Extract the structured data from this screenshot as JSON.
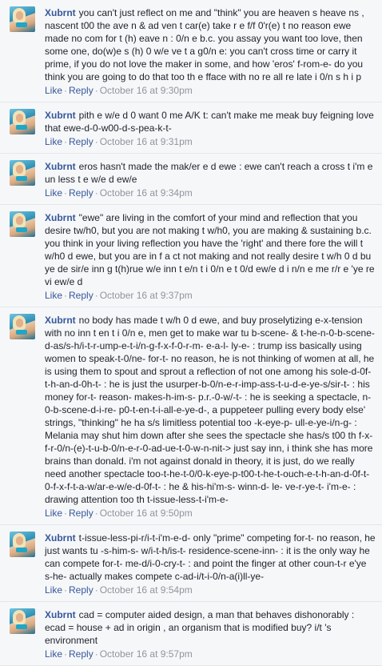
{
  "comments": [
    {
      "author": "Xubrnt",
      "text": "you can't just reflect on me and \"think\" you are heaven s heave ns , nascent t00 the ave n & ad ven t car(e) take r e f/f 0'r(e) t no reason ewe made no com for t (h) eave n : 0/n e b.c. you assay you want too love, then some one, do(w)e s (h) 0 w/e ve t a g0/n e: you can't cross time or carry it prime, if you do not love the maker in some, and how 'eros' f-rom-e- do you think you are going to do that too th e fface with no re all re late i 0/n s h i p",
      "like": "Like",
      "reply": "Reply",
      "time": "October 16 at 9:30pm"
    },
    {
      "author": "Xubrnt",
      "text": "pith e w/e d 0 want 0 me A/K t: can't make me meak buy feigning love that ewe-d-0-w00-d-s-pea-k-t-",
      "like": "Like",
      "reply": "Reply",
      "time": "October 16 at 9:31pm"
    },
    {
      "author": "Xubrnt",
      "text": "eros hasn't made the mak/er e d ewe : ewe can't reach a cross t i'm e un less t e w/e d ew/e",
      "like": "Like",
      "reply": "Reply",
      "time": "October 16 at 9:34pm"
    },
    {
      "author": "Xubrnt",
      "text": "\"ewe\" are living in the comfort of your mind and reflection that you desire tw/h0, but you are not making t w/h0, you are making & sustaining b.c. you think in your living reflection you have the 'right' and there fore the will t w/h0 d ewe, but you are in f a ct not making and not really desire t w/h 0 d bu ye de sir/e inn g t(h)rue w/e inn t e/n t i 0/n e t 0/d ew/e d i n/n e me r/r e 'ye re vi ew/e d",
      "like": "Like",
      "reply": "Reply",
      "time": "October 16 at 9:37pm"
    },
    {
      "author": "Xubrnt",
      "text": "no body has made t w/h 0 d ewe, and buy proselytizing e-x-tension with no inn t en t i 0/n e, men get to make war tu b-scene- & t-he-n-0-b-scene-d-as/s-h/i-t-r-ump-e-t-i/n-g-f-x-f-0-r-m- e-a-l- ly-e- : trump iss basically using women to speak-t-0/ne- for-t- no reason, he is not thinking of women at all, he is using them to spout and sprout a reflection of not one among his sole-d-0f-t-h-an-d-0h-t- : he is just the usurper-b-0/n-e-r-imp-ass-t-u-d-e-ye-s/sir-t- : his money for-t- reason- makes-h-im-s- p.r.-0-w/-t- : he is seeking a spectacle, n-0-b-scene-d-i-re- p0-t-en-t-i-all-e-ye-d-, a puppeteer pulling every body else' strings, \"thinking\" he ha s/s limitless potential too -k-eye-p- ull-e-ye-i/n-g- : Melania may shut him down after she sees the spectacle she has/s t00 th f-x-f-r-0/n-(e)-t-u-b-0/n-e-r-0-ad-ue-t-0-w-n-nit-> just say inn, i think she has more brains than donald. i'm not against donald in theory, it is just, do we really need another spectacle too-t-he-t-0/0-k-eye-p-t00-t-he-t-ouch-e-t-h-an-d-0f-t-0-f-x-f-t-a-w/ar-e-w/e-d-0f-t- : he & his-hi'm-s- winn-d- le- ve-r-ye-t- i'm-e- : drawing attention too th t-issue-less-t-i'm-e-",
      "like": "Like",
      "reply": "Reply",
      "time": "October 16 at 9:50pm"
    },
    {
      "author": "Xubrnt",
      "text": "t-issue-less-pi-r/i-t-i'm-e-d- only \"prime\" competing for-t- no reason, he just wants tu -s-him-s- w/i-t-h/is-t- residence-scene-inn- : it is the only way he can compete for-t- me-d/i-0-cry-t- : and point the finger at other coun-t-r e'ye s-he- actually makes compete c-ad-i/t-i-0/n-a(i)ll-ye-",
      "like": "Like",
      "reply": "Reply",
      "time": "October 16 at 9:54pm"
    },
    {
      "author": "Xubrnt",
      "text": "cad = computer aided design, a man that behaves dishonorably : ecad = house + ad in origin , an organism that is modified buy? i/t 's environment",
      "like": "Like",
      "reply": "Reply",
      "time": "October 16 at 9:57pm"
    }
  ]
}
